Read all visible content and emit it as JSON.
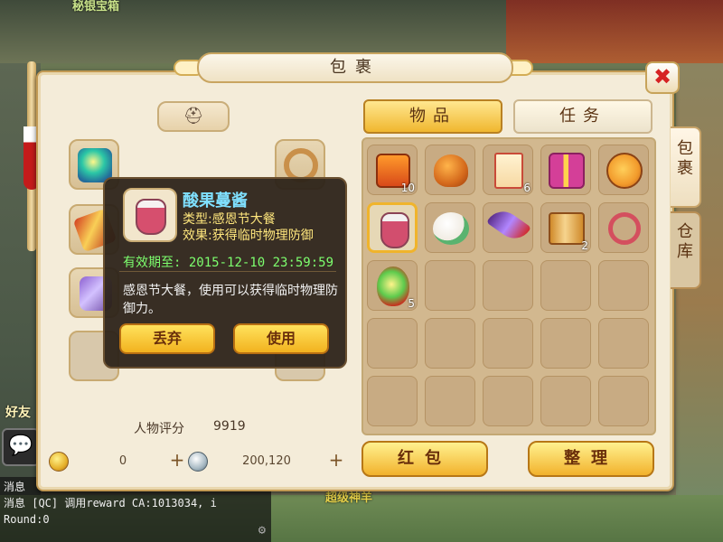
{
  "background": {
    "top_label": "秘银宝箱",
    "bottom_label": "超级神羊",
    "friend_label": "好友",
    "chat_log": [
      "消息",
      "消息 [QC] 调用reward CA:1013034, i",
      "Round:0"
    ]
  },
  "window": {
    "title": "包裹",
    "close_symbol": "✖"
  },
  "left_panel": {
    "weapon_tab_icon": "helmet-icon",
    "score_label": "人物评分",
    "score_value": "9919",
    "gold_value": "0",
    "silver_value": "200,120",
    "plus_symbol": "+"
  },
  "tooltip": {
    "name": "酸果蔓酱",
    "type_label": "类型:",
    "type_value": "感恩节大餐",
    "effect_label": "效果:",
    "effect_value": "获得临时物理防御",
    "expire_label": "有效期至:",
    "expire_value": "2015-12-10 23:59:59",
    "description": "感恩节大餐，使用可以获得临时物理防御力。",
    "discard_label": "丢弃",
    "use_label": "使用"
  },
  "inventory": {
    "tab_items": "物品",
    "tab_tasks": "任务",
    "side_tabs": [
      "包裹",
      "仓库"
    ],
    "slots": [
      {
        "icon": "crate-icon",
        "qty": "10"
      },
      {
        "icon": "bag-icon",
        "qty": ""
      },
      {
        "icon": "envelope-icon",
        "qty": "6"
      },
      {
        "icon": "gift-icon",
        "qty": ""
      },
      {
        "icon": "pizza-icon",
        "qty": ""
      },
      {
        "icon": "jam-icon",
        "qty": ""
      },
      {
        "icon": "bun-icon",
        "qty": ""
      },
      {
        "icon": "feather-icon",
        "qty": ""
      },
      {
        "icon": "scroll-icon",
        "qty": "2"
      },
      {
        "icon": "rope-icon",
        "qty": ""
      },
      {
        "icon": "gourd-icon",
        "qty": "5"
      }
    ],
    "selected_slot_index": 5,
    "redpacket_label": "红包",
    "sort_label": "整理"
  },
  "colors": {
    "accent_gold": "#f2b22c",
    "tooltip_name": "#7fe0ff",
    "tooltip_text": "#ffe77d",
    "expire_text": "#7dff6e"
  }
}
